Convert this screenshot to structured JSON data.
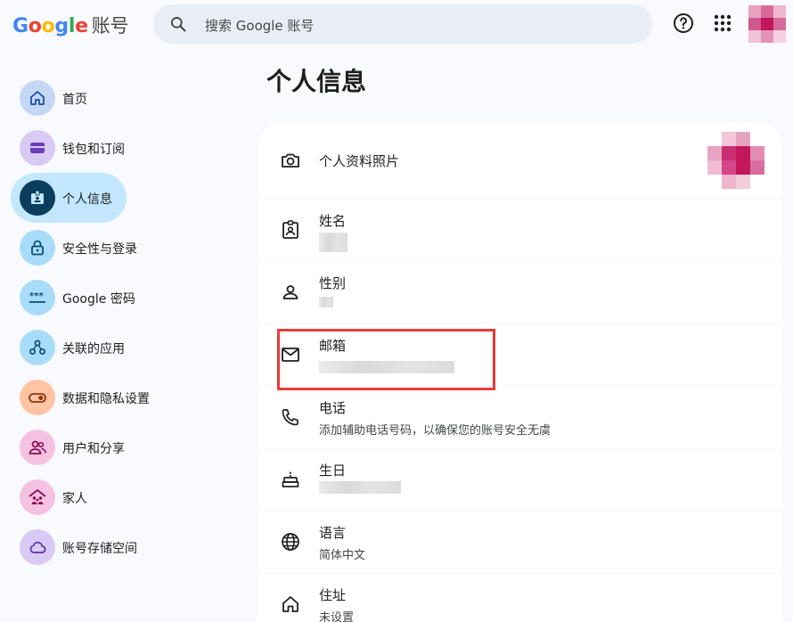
{
  "header": {
    "logo_word": "Google",
    "logo_suffix": "账号",
    "search_placeholder": "搜索 Google 账号"
  },
  "sidebar": {
    "items": [
      {
        "label": "首页",
        "icon": "home-icon",
        "color": "#c4d7f5",
        "active": false
      },
      {
        "label": "钱包和订阅",
        "icon": "wallet-icon",
        "color": "#d9c9f5",
        "active": false
      },
      {
        "label": "个人信息",
        "icon": "badge-icon",
        "color": "#0b3d5c",
        "active": true
      },
      {
        "label": "安全性与登录",
        "icon": "lock-icon",
        "color": "#a8dcf8",
        "active": false
      },
      {
        "label": "Google 密码",
        "icon": "password-icon",
        "color": "#a8dcf8",
        "active": false
      },
      {
        "label": "关联的应用",
        "icon": "connected-apps-icon",
        "color": "#a8dcf8",
        "active": false
      },
      {
        "label": "数据和隐私设置",
        "icon": "toggle-icon",
        "color": "#ffc4a3",
        "active": false
      },
      {
        "label": "用户和分享",
        "icon": "people-icon",
        "color": "#f5c2e1",
        "active": false
      },
      {
        "label": "家人",
        "icon": "family-icon",
        "color": "#f5c2e1",
        "active": false
      },
      {
        "label": "账号存储空间",
        "icon": "cloud-icon",
        "color": "#d9c9f5",
        "active": false
      }
    ]
  },
  "main": {
    "title": "个人信息",
    "rows": [
      {
        "key": "photo",
        "title": "个人资料照片",
        "icon": "camera-icon"
      },
      {
        "key": "name",
        "title": "姓名",
        "icon": "contact-card-icon",
        "value_hidden": true
      },
      {
        "key": "gender",
        "title": "性别",
        "icon": "person-icon",
        "value_hidden": true
      },
      {
        "key": "email",
        "title": "邮箱",
        "icon": "mail-icon",
        "value_hidden": true
      },
      {
        "key": "phone",
        "title": "电话",
        "icon": "phone-icon",
        "subtitle": "添加辅助电话号码，以确保您的账号安全无虞"
      },
      {
        "key": "birthday",
        "title": "生日",
        "icon": "cake-icon",
        "value_hidden": true
      },
      {
        "key": "language",
        "title": "语言",
        "icon": "globe-icon",
        "subtitle": "简体中文"
      },
      {
        "key": "address",
        "title": "住址",
        "icon": "home-icon",
        "subtitle": "未设置"
      }
    ]
  },
  "colors": {
    "active_nav_bg": "#c2e7ff",
    "highlight_border": "#ea3a3a",
    "avatar_pink": "#c2185b"
  }
}
